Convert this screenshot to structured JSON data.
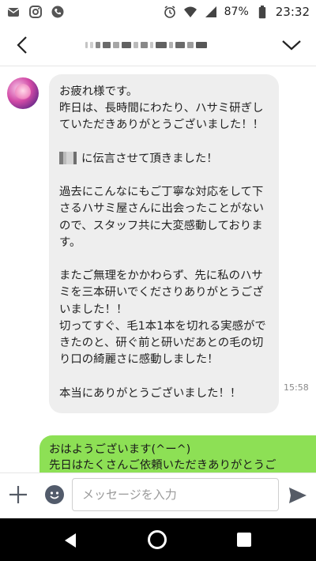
{
  "status_bar": {
    "icons_left": [
      "mail-icon",
      "instagram-icon",
      "phone-icon"
    ],
    "icons_right": [
      "alarm-icon",
      "wifi-icon",
      "signal-icon",
      "battery-icon"
    ],
    "battery": "87%",
    "time": "23:32"
  },
  "header": {
    "back_icon": "chevron-left-icon",
    "menu_icon": "chevron-down-icon"
  },
  "messages": {
    "incoming": {
      "line1": "お疲れ様です。\n昨日は、長時間にわたり、ハサミ研ぎしていただきありがとうございました！！\n\n",
      "line2": "に伝言させて頂きました！\n\n過去にこんなにもご丁寧な対応をして下さるハサミ屋さんに出会ったことがないので、スタッフ共に大変感動しております。\n\nまたご無理をかかわらず、先に私のハサミを三本研いでくださりありがとうございました！！\n切ってすぐ、毛1本1本を切れる実感ができたのと、研ぐ前と研いだあとの毛の切り口の綺麗さに感動しました！\n\n本当にありがとうございました！！",
      "time": "15:58"
    },
    "outgoing": {
      "text": "おはようございます(^ー^)\n先日はたくさんご依頼いただきありがとうご"
    }
  },
  "input_bar": {
    "placeholder": "メッセージを入力",
    "value": ""
  },
  "colors": {
    "incoming_bubble": "#eeeeee",
    "outgoing_bubble": "#8de055"
  }
}
